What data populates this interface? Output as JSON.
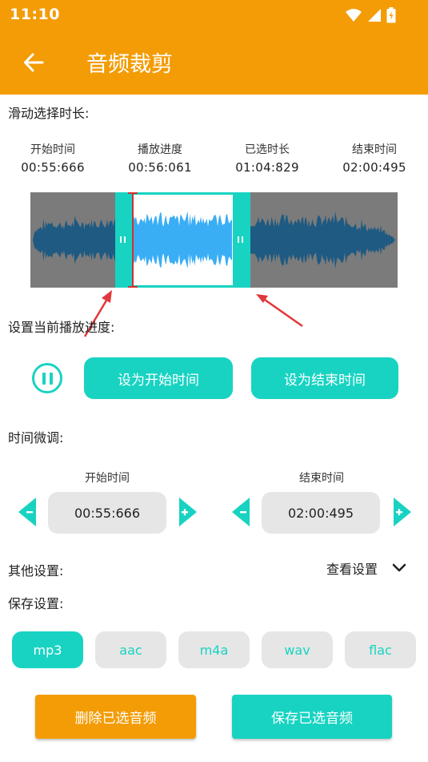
{
  "status_bar": {
    "time": "11:10"
  },
  "app_bar": {
    "title": "音频裁剪"
  },
  "slide_section": {
    "label": "滑动选择时长:",
    "columns": [
      {
        "heading": "开始时间",
        "value": "00:55:666"
      },
      {
        "heading": "播放进度",
        "value": "00:56:061"
      },
      {
        "heading": "已选时长",
        "value": "01:04:829"
      },
      {
        "heading": "结束时间",
        "value": "02:00:495"
      }
    ]
  },
  "playback_section": {
    "label": "设置当前播放进度:",
    "set_start_label": "设为开始时间",
    "set_end_label": "设为结束时间"
  },
  "fine_tune": {
    "label": "时间微调:",
    "start_heading": "开始时间",
    "start_value": "00:55:666",
    "end_heading": "结束时间",
    "end_value": "02:00:495"
  },
  "other_settings": {
    "label": "其他设置:",
    "view_label": "查看设置"
  },
  "save_settings": {
    "label": "保存设置:",
    "formats": [
      "mp3",
      "aac",
      "m4a",
      "wav",
      "flac"
    ],
    "selected": "mp3"
  },
  "actions": {
    "delete_label": "删除已选音频",
    "save_label": "保存已选音频"
  },
  "colors": {
    "primary_orange": "#F39C06",
    "accent_teal": "#18D3C2",
    "wave_dark": "#1E5A82",
    "wave_light": "#3AAEF5",
    "selection_marker": "#D23030"
  }
}
